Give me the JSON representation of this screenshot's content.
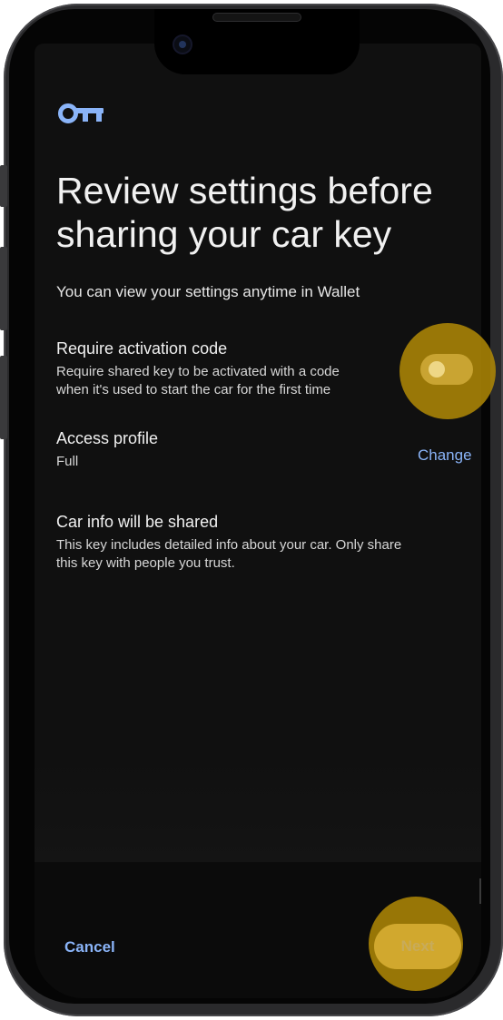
{
  "header": {
    "key_icon": "car-key-icon",
    "title": "Review settings before sharing your car key",
    "subtitle": "You can view your settings anytime in Wallet"
  },
  "settings": {
    "activation": {
      "title": "Require activation code",
      "description_line1": "Require shared key to be activated with a code",
      "description_line2": "when it's used to start the car for the first time",
      "toggle_on": false
    },
    "access_profile": {
      "title": "Access profile",
      "value": "Full",
      "change_label": "Change"
    },
    "car_info": {
      "title": "Car info will be shared",
      "description_line1": "This key includes detailed info about your car. Only share",
      "description_line2": "this key with people you trust."
    }
  },
  "footer": {
    "cancel_label": "Cancel",
    "next_label": "Next"
  },
  "colors": {
    "accent": "#8ab4f8",
    "background": "#101010",
    "highlight": "#b08806"
  }
}
